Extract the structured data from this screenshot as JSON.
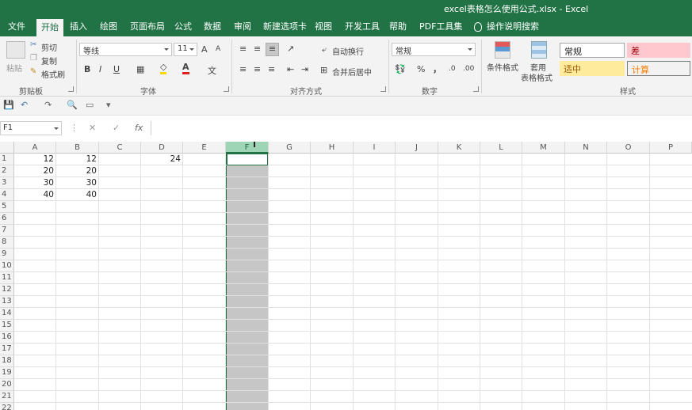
{
  "window": {
    "title": "excel表格怎么使用公式.xlsx  -  Excel"
  },
  "tabs": [
    "文件",
    "开始",
    "插入",
    "绘图",
    "页面布局",
    "公式",
    "数据",
    "审阅",
    "新建选项卡",
    "视图",
    "开发工具",
    "帮助",
    "PDF工具集",
    "操作说明搜索"
  ],
  "active_tab": "开始",
  "ribbon": {
    "clipboard": {
      "paste": "粘贴",
      "cut": "剪切",
      "copy": "复制",
      "format_painter": "格式刷",
      "label": "剪贴板"
    },
    "font": {
      "name": "等线",
      "size": "11",
      "grow": "A",
      "shrink": "A",
      "bold": "B",
      "italic": "I",
      "underline": "U",
      "font_color_icon": "A",
      "label": "字体"
    },
    "alignment": {
      "wrap": "自动换行",
      "merge": "合并后居中",
      "label": "对齐方式"
    },
    "number": {
      "format": "常规",
      "percent": "%",
      "comma": "，",
      "label": "数字"
    },
    "styles": {
      "conditional": "条件格式",
      "table_format": "套用",
      "table_format2": "表格格式",
      "normal": "常规",
      "bad": "差",
      "neutral": "适中",
      "calc": "计算",
      "label": "样式"
    }
  },
  "colors": {
    "brand": "#217346",
    "bad_bg": "#ffc7ce",
    "bad_fg": "#9c0006",
    "neutral_bg": "#ffeb9c",
    "neutral_fg": "#9c5700",
    "calc_fg": "#fa7d00"
  },
  "formula_bar": {
    "name_box": "F1",
    "cancel": "✕",
    "enter": "✓",
    "fx": "fx",
    "value": ""
  },
  "columns": [
    "A",
    "B",
    "C",
    "D",
    "E",
    "F",
    "G",
    "H",
    "I",
    "J",
    "K",
    "L",
    "M",
    "N",
    "O",
    "P"
  ],
  "selected_column": "F",
  "rows": [
    "1",
    "2",
    "3",
    "4",
    "5",
    "6",
    "7",
    "8",
    "9",
    "10",
    "11",
    "12",
    "13",
    "14",
    "15",
    "16",
    "17",
    "18",
    "19",
    "20",
    "21",
    "22"
  ],
  "cells": [
    {
      "ref": "A1",
      "value": "12"
    },
    {
      "ref": "B1",
      "value": "12"
    },
    {
      "ref": "D1",
      "value": "24"
    },
    {
      "ref": "A2",
      "value": "20"
    },
    {
      "ref": "B2",
      "value": "20"
    },
    {
      "ref": "A3",
      "value": "30"
    },
    {
      "ref": "B3",
      "value": "30"
    },
    {
      "ref": "A4",
      "value": "40"
    },
    {
      "ref": "B4",
      "value": "40"
    }
  ]
}
